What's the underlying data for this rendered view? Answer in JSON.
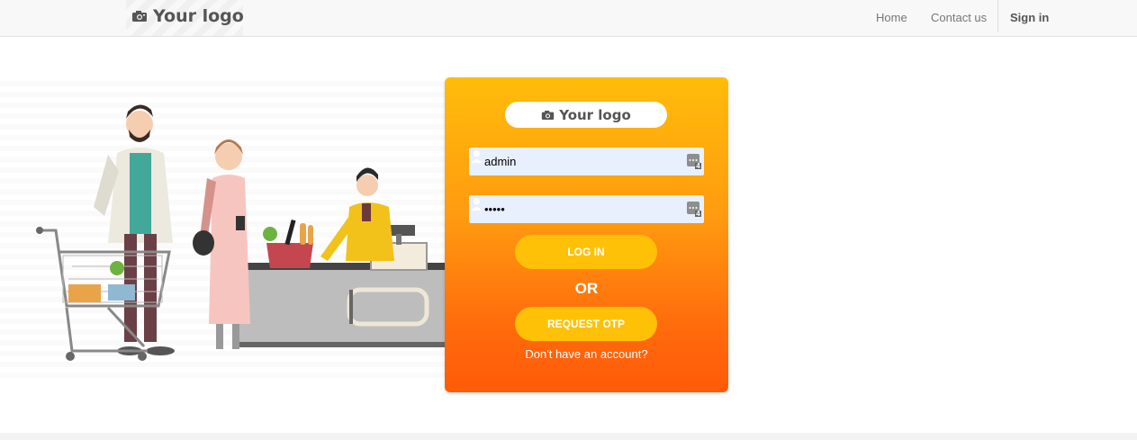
{
  "header": {
    "logo_text": "Your logo",
    "nav": {
      "home": "Home",
      "contact": "Contact us",
      "signin": "Sign in"
    }
  },
  "card": {
    "logo_text": "Your logo",
    "username_value": "admin",
    "password_value": "•••••",
    "key_badge": "4",
    "login_label": "LOG IN",
    "or_label": "OR",
    "otp_label": "REQUEST OTP",
    "signup_link": "Don't have an account?"
  },
  "colors": {
    "card_top": "#ffbc0a",
    "card_bottom": "#ff5a08",
    "button": "#ffc107",
    "input_bg": "#e8f0fe"
  },
  "icons": {
    "logo": "camera-icon",
    "username": "user-icon",
    "password": "user-icon",
    "autofill": "password-manager-key-icon"
  }
}
